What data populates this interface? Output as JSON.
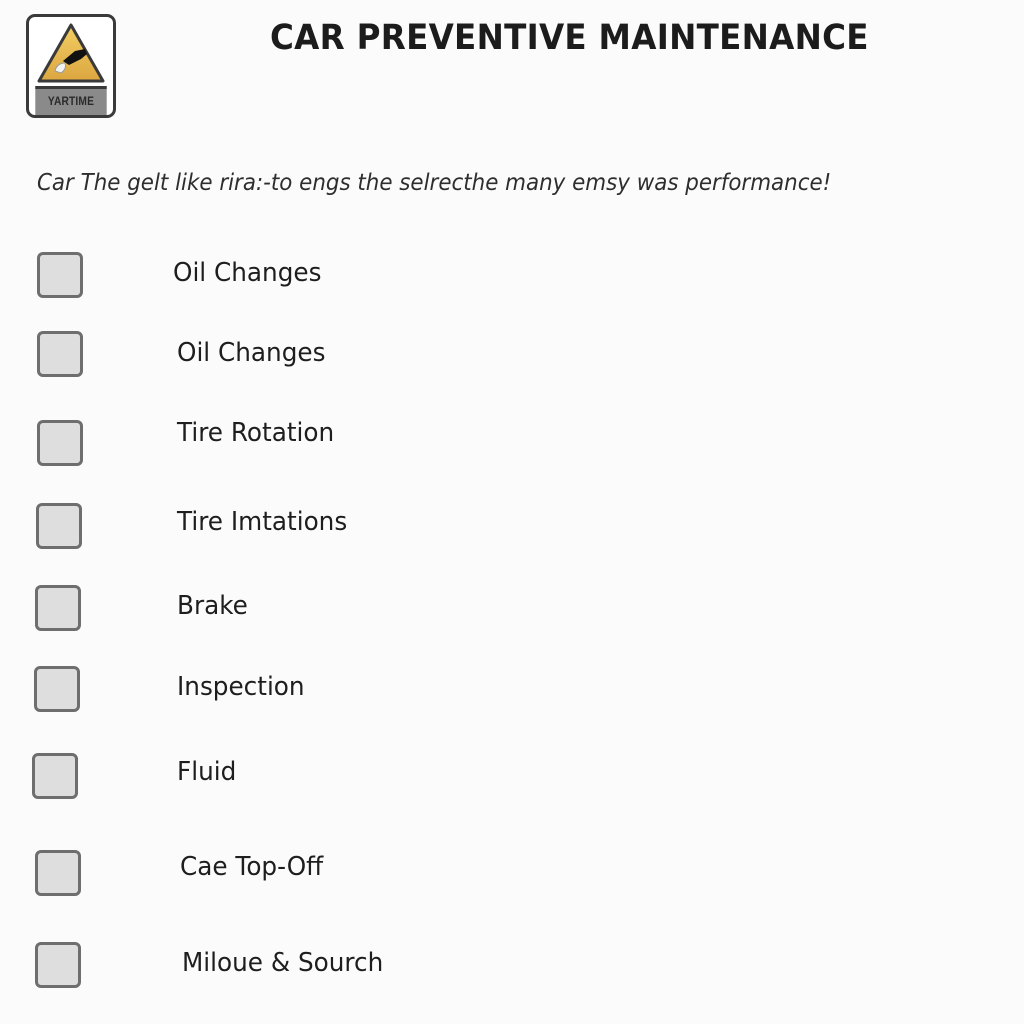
{
  "logo": {
    "icon": "warning-triangle-car-icon",
    "label": "YARTIME",
    "colors": {
      "triangle": "#e8b94a",
      "frame": "#3a3a3a",
      "band": "#8a8a8a"
    }
  },
  "header": {
    "title": "CAR PREVENTIVE MAINTENANCE"
  },
  "subtitle": "Car The gelt like rira:-to engs the selrecthe many emsy was performance!",
  "checklist": {
    "items": [
      {
        "label": "Oil Changes",
        "checked": false
      },
      {
        "label": "Oil Changes",
        "checked": false
      },
      {
        "label": "Tire Rotation",
        "checked": false
      },
      {
        "label": "Tire Imtations",
        "checked": false
      },
      {
        "label": "Brake",
        "checked": false
      },
      {
        "label": "Inspection",
        "checked": false
      },
      {
        "label": "Fluid",
        "checked": false
      },
      {
        "label": "Cae Top-Off",
        "checked": false
      },
      {
        "label": "Miloue & Sourch",
        "checked": false
      }
    ]
  }
}
